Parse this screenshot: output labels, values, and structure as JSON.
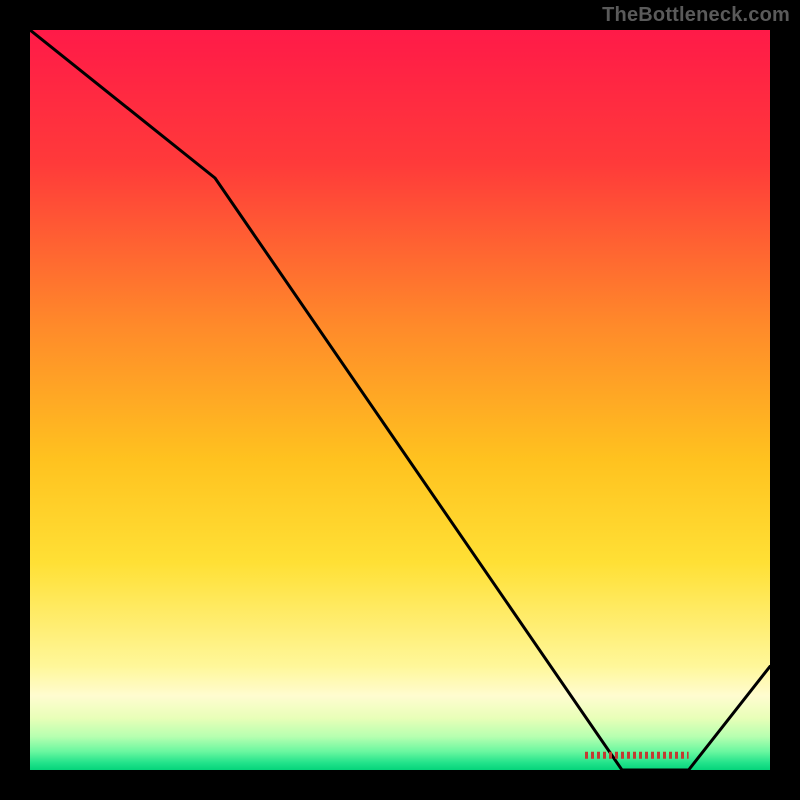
{
  "watermark": "TheBottleneck.com",
  "chart_data": {
    "type": "line",
    "title": "",
    "xlabel": "",
    "ylabel": "",
    "x": [
      0,
      25,
      80,
      89,
      100
    ],
    "values": [
      100,
      80,
      0,
      0,
      14
    ],
    "xlim": [
      0,
      100
    ],
    "ylim": [
      0,
      100
    ],
    "dash_segment": {
      "x_from": 75,
      "x_to": 89,
      "y": 2
    },
    "background_stops": [
      {
        "offset": 0.0,
        "color": "#ff1a48"
      },
      {
        "offset": 0.18,
        "color": "#ff3a3a"
      },
      {
        "offset": 0.4,
        "color": "#ff8a2a"
      },
      {
        "offset": 0.58,
        "color": "#ffc21f"
      },
      {
        "offset": 0.72,
        "color": "#ffe035"
      },
      {
        "offset": 0.86,
        "color": "#fff79a"
      },
      {
        "offset": 0.9,
        "color": "#fffcd0"
      },
      {
        "offset": 0.93,
        "color": "#e8ffb8"
      },
      {
        "offset": 0.955,
        "color": "#b6ffb0"
      },
      {
        "offset": 0.975,
        "color": "#6af7a0"
      },
      {
        "offset": 0.99,
        "color": "#23e38b"
      },
      {
        "offset": 1.0,
        "color": "#05d47b"
      }
    ],
    "line_color": "#000000",
    "dash_color": "#c23a32"
  }
}
